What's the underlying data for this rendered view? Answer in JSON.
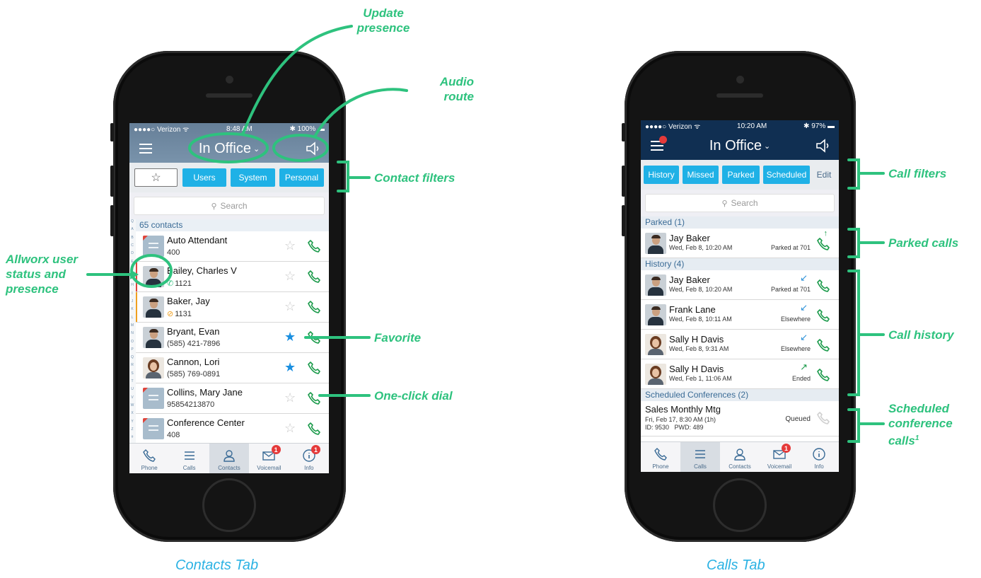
{
  "colors": {
    "accent": "#1fb1e6",
    "annotation": "#2ec27e",
    "caption": "#2bb2e3",
    "header_left": "#6e8aa3",
    "header_right": "#0f2f54",
    "call_green": "#1a9a4a",
    "favorite": "#1a8fe0",
    "presence_busy": "#f0a020",
    "presence_red": "#e0443a"
  },
  "annotations": {
    "update_presence": "Update\npresence",
    "audio_route": "Audio\nroute",
    "contact_filters": "Contact filters",
    "allworx_user": "Allworx user\nstatus and\npresence",
    "favorite": "Favorite",
    "one_click_dial": "One-click dial",
    "call_filters": "Call filters",
    "parked_calls": "Parked calls",
    "call_history": "Call history",
    "scheduled_conf": "Scheduled\nconference\ncalls",
    "scheduled_sup": "1"
  },
  "captions": {
    "left": "Contacts Tab",
    "right": "Calls Tab"
  },
  "left_phone": {
    "status": {
      "carrier": "●●●●○ Verizon ᯤ",
      "time": "8:48 AM",
      "battery": "✱ 100% ▬"
    },
    "presence_label": "In Office",
    "filters": [
      "☆",
      "Users",
      "System",
      "Personal"
    ],
    "search_placeholder": "Search",
    "contacts_count": "65 contacts",
    "alpha": [
      "Q",
      "A",
      "B",
      "C",
      "D",
      "E",
      "F",
      "G",
      "H",
      "I",
      "J",
      "K",
      "L",
      "M",
      "N",
      "O",
      "P",
      "Q",
      "R",
      "S",
      "T",
      "U",
      "V",
      "W",
      "X",
      "Y",
      "Z",
      "#"
    ],
    "contacts": [
      {
        "name": "Auto Attendant",
        "sub": "400",
        "fav": false,
        "avatar": "system-attendant-icon"
      },
      {
        "name": "Bailey, Charles V",
        "sub": "1121",
        "fav": false,
        "avatar": "photo-man"
      },
      {
        "name": "Baker, Jay",
        "sub": "1131",
        "fav": false,
        "avatar": "photo-man"
      },
      {
        "name": "Bryant, Evan",
        "sub": "(585) 421-7896",
        "fav": true,
        "avatar": "photo-man"
      },
      {
        "name": "Cannon, Lori",
        "sub": "(585) 769-0891",
        "fav": true,
        "avatar": "photo-woman"
      },
      {
        "name": "Collins, Mary Jane",
        "sub": "95854213870",
        "fav": false,
        "avatar": "system-call-route-icon"
      },
      {
        "name": "Conference Center",
        "sub": "408",
        "fav": false,
        "avatar": "system-conference-icon"
      }
    ],
    "tabs": [
      {
        "label": "Phone",
        "icon": "phone-icon"
      },
      {
        "label": "Calls",
        "icon": "list-icon"
      },
      {
        "label": "Contacts",
        "icon": "person-icon",
        "active": true
      },
      {
        "label": "Voicemail",
        "icon": "envelope-icon",
        "badge": "1"
      },
      {
        "label": "Info",
        "icon": "info-icon",
        "badge": "1"
      }
    ]
  },
  "right_phone": {
    "status": {
      "carrier": "●●●●○ Verizon ᯤ",
      "time": "10:20 AM",
      "battery": "✱ 97% ▬"
    },
    "presence_label": "In Office",
    "filters": [
      "History",
      "Missed",
      "Parked",
      "Scheduled",
      "Edit"
    ],
    "search_placeholder": "Search",
    "parked_header": "Parked (1)",
    "parked": [
      {
        "name": "Jay Baker",
        "date": "Wed, Feb 8, 10:20 AM",
        "status": "Parked at 701"
      }
    ],
    "history_header": "History (4)",
    "history": [
      {
        "name": "Jay Baker",
        "date": "Wed, Feb 8, 10:20 AM",
        "status": "Parked at 701",
        "direction": "incoming"
      },
      {
        "name": "Frank Lane",
        "date": "Wed, Feb 8, 10:11 AM",
        "status": "Elsewhere",
        "direction": "incoming"
      },
      {
        "name": "Sally H Davis",
        "date": "Wed, Feb 8, 9:31 AM",
        "status": "Elsewhere",
        "direction": "incoming"
      },
      {
        "name": "Sally H Davis",
        "date": "Wed, Feb 1, 11:06 AM",
        "status": "Ended",
        "direction": "outgoing"
      }
    ],
    "scheduled_header": "Scheduled Conferences (2)",
    "scheduled": [
      {
        "title": "Sales Monthly Mtg",
        "line1": "Fri, Feb 17, 8:30 AM (1h)",
        "line2": "ID: 9530   PWD: 489",
        "status": "Queued"
      }
    ],
    "tabs": [
      {
        "label": "Phone",
        "icon": "phone-icon"
      },
      {
        "label": "Calls",
        "icon": "list-icon",
        "active": true
      },
      {
        "label": "Contacts",
        "icon": "person-icon"
      },
      {
        "label": "Voicemail",
        "icon": "envelope-icon",
        "badge": "1"
      },
      {
        "label": "Info",
        "icon": "info-icon"
      }
    ]
  }
}
